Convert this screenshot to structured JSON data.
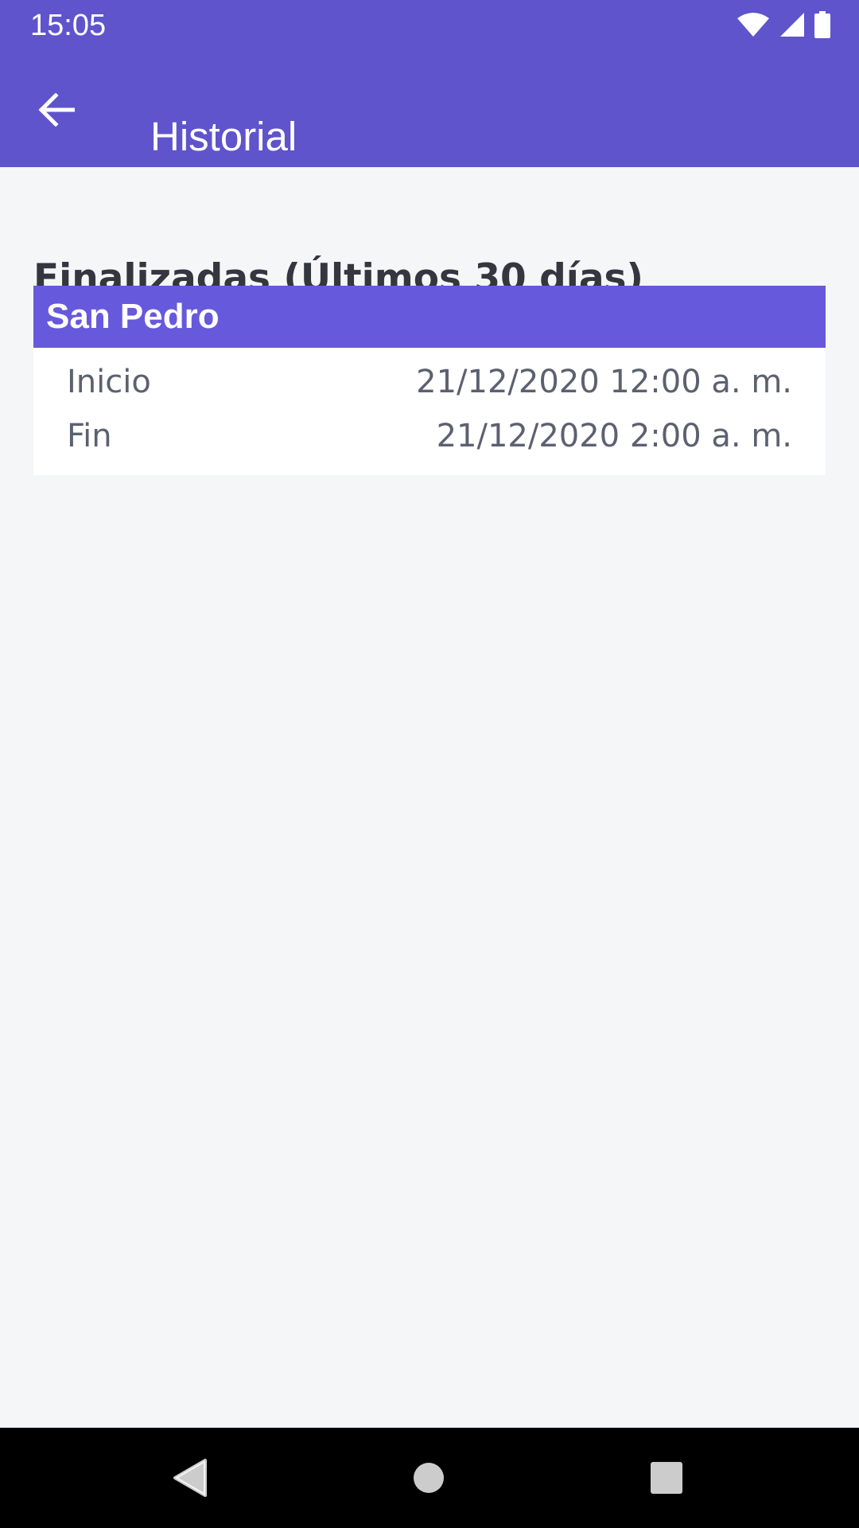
{
  "status_bar": {
    "time": "15:05",
    "icons": [
      "wifi-icon",
      "cell-signal-icon",
      "battery-icon"
    ]
  },
  "app_bar": {
    "title": "Historial",
    "back_icon": "arrow-left-icon",
    "background_color": "#5f54cc"
  },
  "section": {
    "title": "Finalizadas (Últimos 30 días)"
  },
  "history_items": [
    {
      "name": "San Pedro",
      "start_label": "Inicio",
      "start_value": "21/12/2020 12:00 a. m.",
      "end_label": "Fin",
      "end_value": "21/12/2020 2:00 a. m."
    }
  ],
  "nav_bar": {
    "buttons": [
      "back-triangle-icon",
      "home-circle-icon",
      "recents-square-icon"
    ]
  },
  "colors": {
    "primary": "#5f54cc",
    "card_header": "#6759dc",
    "background": "#f5f6f8",
    "heading_text": "#343640",
    "body_text": "#5c6170"
  }
}
